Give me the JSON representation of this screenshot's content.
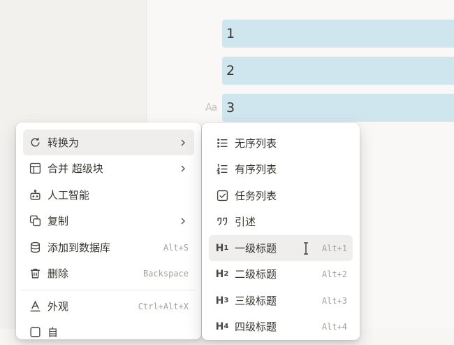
{
  "editor": {
    "blocks": [
      "1",
      "2",
      "3"
    ],
    "text_type_icon": "Aa"
  },
  "context_menu": {
    "items": [
      {
        "label": "转换为",
        "icon": "turn-into-icon",
        "has_submenu": true
      },
      {
        "label": "合并 超级块",
        "icon": "layout-icon",
        "has_submenu": true
      },
      {
        "label": "人工智能",
        "icon": "robot-icon"
      },
      {
        "label": "复制",
        "icon": "copy-icon",
        "has_submenu": true
      },
      {
        "label": "添加到数据库",
        "icon": "database-icon",
        "shortcut": "Alt+S"
      },
      {
        "label": "删除",
        "icon": "trash-icon",
        "shortcut": "Backspace"
      },
      {
        "label": "外观",
        "icon": "text-color-icon",
        "shortcut": "Ctrl+Alt+X"
      },
      {
        "label": "自",
        "icon": "more-icon"
      }
    ]
  },
  "submenu": {
    "items": [
      {
        "label": "无序列表",
        "icon": "bulleted-list-icon"
      },
      {
        "label": "有序列表",
        "icon": "numbered-list-icon"
      },
      {
        "label": "任务列表",
        "icon": "checkbox-icon"
      },
      {
        "label": "引述",
        "icon": "quote-icon"
      },
      {
        "label": "一级标题",
        "icon": "heading-1-icon",
        "shortcut": "Alt+1"
      },
      {
        "label": "二级标题",
        "icon": "heading-2-icon",
        "shortcut": "Alt+2"
      },
      {
        "label": "三级标题",
        "icon": "heading-3-icon",
        "shortcut": "Alt+3"
      },
      {
        "label": "四级标题",
        "icon": "heading-4-icon",
        "shortcut": "Alt+4"
      }
    ]
  },
  "heading_icon_text": {
    "h": "H",
    "n1": "1",
    "n2": "2",
    "n3": "3",
    "n4": "4"
  },
  "colors": {
    "block_bg": "#cfe6ee",
    "highlight": "#efeeec",
    "menu_bg": "#ffffff"
  }
}
